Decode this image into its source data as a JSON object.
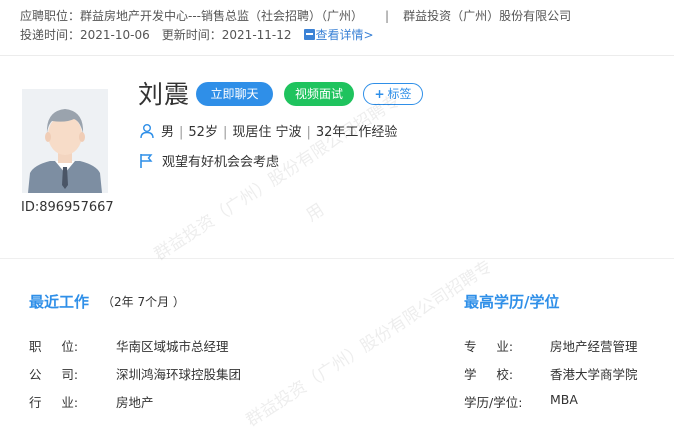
{
  "header": {
    "position_label": "应聘职位：",
    "position_value": "群益房地产开发中心---销售总监（社会招聘）（广州）",
    "separator": "|",
    "company": "群益投资（广州）股份有限公司",
    "submit_label": "投递时间：",
    "submit_date": "2021-10-06",
    "update_label": "更新时间：",
    "update_date": "2021-11-12",
    "detail_link": "查看详情>"
  },
  "profile": {
    "id_label": "ID:896957667",
    "name": "刘震",
    "chat_button": "立即聊天",
    "video_button": "视频面试",
    "tag_button": "标签",
    "tag_plus": "+",
    "gender": "男",
    "age": "52岁",
    "residence": "现居住 宁波",
    "experience": "32年工作经验",
    "divider": "|",
    "job_status": "观望有好机会会考虑"
  },
  "recent_work": {
    "title": "最近工作",
    "duration": "（2年 7个月 ）",
    "rows": [
      {
        "label": "职      位:",
        "value": "华南区域城市总经理"
      },
      {
        "label": "公      司:",
        "value": "深圳鸿海环球控股集团"
      },
      {
        "label": "行      业:",
        "value": "房地产"
      }
    ]
  },
  "education": {
    "title": "最高学历/学位",
    "rows": [
      {
        "label": "专      业:",
        "value": "房地产经营管理"
      },
      {
        "label": "学      校:",
        "value": "香港大学商学院"
      },
      {
        "label": "学历/学位:",
        "value": "MBA"
      }
    ]
  },
  "watermark": {
    "line1": "群益投资（广州）股份有限公司招聘专",
    "line2": "用"
  },
  "colors": {
    "accent": "#2f8fe8",
    "video": "#1fc35e",
    "link": "#3b82d6"
  }
}
